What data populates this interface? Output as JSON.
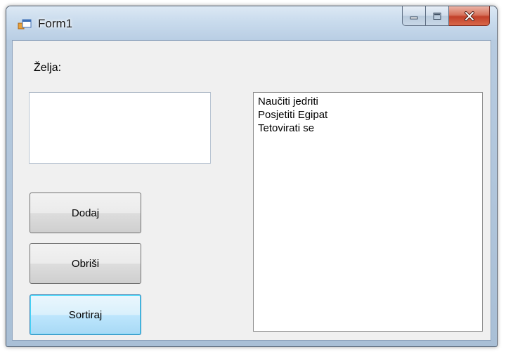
{
  "window": {
    "title": "Form1",
    "icon": "form-app-icon",
    "controls": {
      "minimize_icon": "minimize-icon",
      "maximize_icon": "maximize-icon",
      "close_icon": "close-icon"
    }
  },
  "form": {
    "wish_label": "Želja:",
    "wish_input_value": "",
    "buttons": {
      "add_label": "Dodaj",
      "delete_label": "Obriši",
      "sort_label": "Sortiraj"
    },
    "wish_list": [
      "Naučiti jedriti",
      "Posjetiti Egipat",
      "Tetovirati se"
    ]
  },
  "colors": {
    "title_gradient": "#c9dbed",
    "close_button": "#c2412a",
    "focused_button_border": "#3c7fb1",
    "client_background": "#f0f0f0"
  }
}
